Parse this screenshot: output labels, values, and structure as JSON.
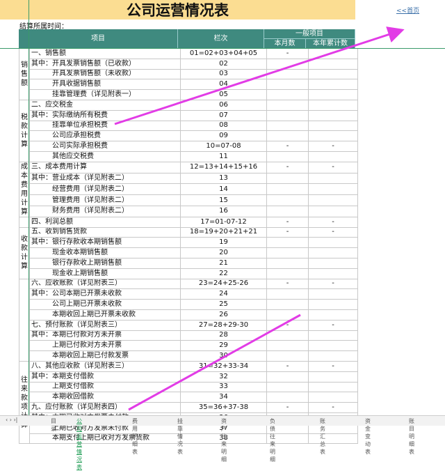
{
  "title": "公司运营情况表",
  "home_link": "<<首页",
  "period_label": "结算所属时间：",
  "header": {
    "item": "项目",
    "code": "栏次",
    "group": "一般项目",
    "month": "本月数",
    "year": "本年累计数"
  },
  "groups": [
    {
      "label": "销售额"
    },
    {
      "label": "税款计算"
    },
    {
      "label": "成本费用计算"
    },
    {
      "label": ""
    },
    {
      "label": "收款计算"
    },
    {
      "label": ""
    },
    {
      "label": "往来款项计算"
    }
  ],
  "rows": [
    {
      "item": "一、销售额",
      "code": "01=02+03+04+05",
      "m": "-",
      "y": "-"
    },
    {
      "item": "其中：开具发票销售额（已收款）",
      "code": "02",
      "m": "",
      "y": ""
    },
    {
      "item": "　　　开具发票销售额（未收款）",
      "code": "03",
      "m": "",
      "y": ""
    },
    {
      "item": "　　　开具收据销售额",
      "code": "04",
      "m": "",
      "y": ""
    },
    {
      "item": "　　　挂靠管理费（详见附表一）",
      "code": "05",
      "m": "",
      "y": ""
    },
    {
      "item": "二、应交税金",
      "code": "06",
      "m": "",
      "y": ""
    },
    {
      "item": "其中：实际缴纳所有税费",
      "code": "07",
      "m": "",
      "y": ""
    },
    {
      "item": "　　　挂靠单位承担税费",
      "code": "08",
      "m": "",
      "y": ""
    },
    {
      "item": "　　　公司应承担税费",
      "code": "09",
      "m": "",
      "y": ""
    },
    {
      "item": "　　　公司实际承担税费",
      "code": "10=07-08",
      "m": "-",
      "y": "-"
    },
    {
      "item": "　　　其他应交税费",
      "code": "11",
      "m": "",
      "y": ""
    },
    {
      "item": "三、成本费用计算",
      "code": "12=13+14+15+16",
      "m": "-",
      "y": "-"
    },
    {
      "item": "其中：营业成本（详见附表二）",
      "code": "13",
      "m": "",
      "y": ""
    },
    {
      "item": "　　　经营费用（详见附表二）",
      "code": "14",
      "m": "",
      "y": ""
    },
    {
      "item": "　　　管理费用（详见附表二）",
      "code": "15",
      "m": "",
      "y": ""
    },
    {
      "item": "　　　财务费用（详见附表二）",
      "code": "16",
      "m": "",
      "y": ""
    },
    {
      "item": "四、利润总额",
      "code": "17=01-07-12",
      "m": "-",
      "y": "-"
    },
    {
      "item": "五、收到销售货款",
      "code": "18=19+20+21+21",
      "m": "-",
      "y": "-"
    },
    {
      "item": "其中：银行存款收本期销售额",
      "code": "19",
      "m": "",
      "y": ""
    },
    {
      "item": "　　　现金收本期销售额",
      "code": "20",
      "m": "",
      "y": ""
    },
    {
      "item": "　　　银行存款收上期销售额",
      "code": "21",
      "m": "",
      "y": ""
    },
    {
      "item": "　　　现金收上期销售额",
      "code": "22",
      "m": "",
      "y": ""
    },
    {
      "item": "六、应收账款（详见附表三）",
      "code": "23=24+25-26",
      "m": "-",
      "y": "-"
    },
    {
      "item": "其中：公司本期已开票未收款",
      "code": "24",
      "m": "",
      "y": ""
    },
    {
      "item": "　　　公司上期已开票未收款",
      "code": "25",
      "m": "",
      "y": ""
    },
    {
      "item": "　　　本期收回上期已开票未收款",
      "code": "26",
      "m": "",
      "y": ""
    },
    {
      "item": "七、预付账款（详见附表三）",
      "code": "27=28+29-30",
      "m": "-",
      "y": "-"
    },
    {
      "item": "其中：本期已付款对方未开票",
      "code": "28",
      "m": "",
      "y": ""
    },
    {
      "item": "　　　上期已付款对方未开票",
      "code": "29",
      "m": "",
      "y": ""
    },
    {
      "item": "　　　本期收回上期已付款发票",
      "code": "30",
      "m": "",
      "y": ""
    },
    {
      "item": "八、其他应收款（详见附表三）",
      "code": "31=32+33-34",
      "m": "-",
      "y": "-"
    },
    {
      "item": "其中：本期支付借款",
      "code": "32",
      "m": "",
      "y": ""
    },
    {
      "item": "　　　上期支付借款",
      "code": "33",
      "m": "",
      "y": ""
    },
    {
      "item": "　　　本期收回借款",
      "code": "34",
      "m": "",
      "y": ""
    },
    {
      "item": "九、应付账款（详见附表四）",
      "code": "35=36+37-38",
      "m": "-",
      "y": "-"
    },
    {
      "item": "其中：本期已收对方发票未付款",
      "code": "36",
      "m": "",
      "y": ""
    },
    {
      "item": "　　　上期已收对方发票未付款",
      "code": "37",
      "m": "",
      "y": ""
    },
    {
      "item": "　　　本期支付上期已收对方发票货款",
      "code": "38",
      "m": "",
      "y": ""
    }
  ],
  "tabs": [
    "目录",
    "公司运营情况表",
    "费用明细表",
    "挂靠情况表",
    "资产往来明细",
    "负债往来明细",
    "账务汇总表",
    "资金变动表",
    "账目明细表"
  ],
  "active_tab": 1,
  "colors": {
    "header": "#3f8a7f",
    "title_bg": "#fbdd92",
    "arrow": "#e23ce6"
  }
}
